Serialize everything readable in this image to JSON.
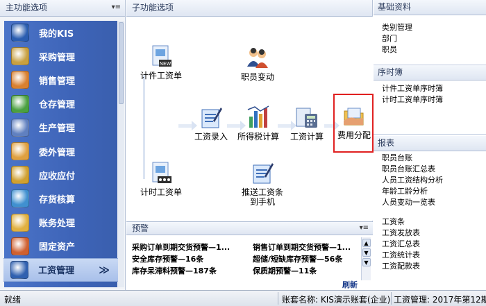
{
  "main_menu": {
    "title": "主功能选项",
    "pin": "▾≡",
    "items": [
      {
        "label": "我的KIS",
        "icon": "kis-book-icon",
        "color": "#2a5db0"
      },
      {
        "label": "采购管理",
        "icon": "purchase-icon",
        "color": "#c8a040"
      },
      {
        "label": "销售管理",
        "icon": "sales-person-icon",
        "color": "#d98030"
      },
      {
        "label": "仓存管理",
        "icon": "warehouse-icon",
        "color": "#4aa040"
      },
      {
        "label": "生产管理",
        "icon": "production-icon",
        "color": "#6080c0"
      },
      {
        "label": "委外管理",
        "icon": "outsource-icon",
        "color": "#e0a040"
      },
      {
        "label": "应收应付",
        "icon": "money-bag-icon",
        "color": "#d0a030"
      },
      {
        "label": "存货核算",
        "icon": "inventory-icon",
        "color": "#4090d0"
      },
      {
        "label": "账务处理",
        "icon": "ledger-icon",
        "color": "#e0b040"
      },
      {
        "label": "固定资产",
        "icon": "fixed-asset-icon",
        "color": "#d06030"
      },
      {
        "label": "工资管理",
        "icon": "salary-icon",
        "color": "#3060b0",
        "active": true,
        "chevron": "≫"
      }
    ]
  },
  "sub_menu": {
    "title": "子功能选项",
    "nodes": {
      "piece_wage_entry": {
        "label": "计件工资单",
        "icon": "new-document-icon"
      },
      "staff_change": {
        "label": "职员变动",
        "icon": "staff-change-icon"
      },
      "wage_entry": {
        "label": "工资录入",
        "icon": "pen-document-icon"
      },
      "income_tax": {
        "label": "所得税计算",
        "icon": "bar-chart-icon"
      },
      "wage_calc": {
        "label": "工资计算",
        "icon": "calculator-icon"
      },
      "cost_alloc": {
        "label": "费用分配",
        "icon": "folder-hand-icon"
      },
      "time_wage": {
        "label": "计时工资单",
        "icon": "time-document-icon"
      },
      "push_wage": {
        "label": "推送工资条到手机",
        "line1": "推送工资条",
        "line2": "到手机",
        "icon": "push-document-icon"
      }
    }
  },
  "warnings": {
    "title": "预警",
    "pin": "▾≡",
    "rows": [
      [
        "采购订单到期交货预警—1...",
        "销售订单到期交货预警—1..."
      ],
      [
        "安全库存预警—16条",
        "超储/短缺库存预警—56条"
      ],
      [
        "库存呆滞料预警—187条",
        "保质期预警—11条"
      ]
    ],
    "refresh": "刷新"
  },
  "right": {
    "basic": {
      "title": "基础资料",
      "items": [
        "类别管理",
        "部门",
        "职员"
      ]
    },
    "timeline": {
      "title": "序时簿",
      "items": [
        "计件工资单序时簿",
        "计时工资单序时簿"
      ]
    },
    "reports": {
      "title": "报表",
      "items": [
        "职员台账",
        "职员台账汇总表",
        "人员工资结构分析",
        "年龄工龄分析",
        "人员变动一览表",
        "工资条",
        "工资发放表",
        "工资汇总表",
        "工资统计表",
        "工资配款表"
      ]
    }
  },
  "status": {
    "state": "就绪",
    "account": "账套名称: KIS演示账套(企业)",
    "module": "工资管理: 2017年第12期"
  }
}
